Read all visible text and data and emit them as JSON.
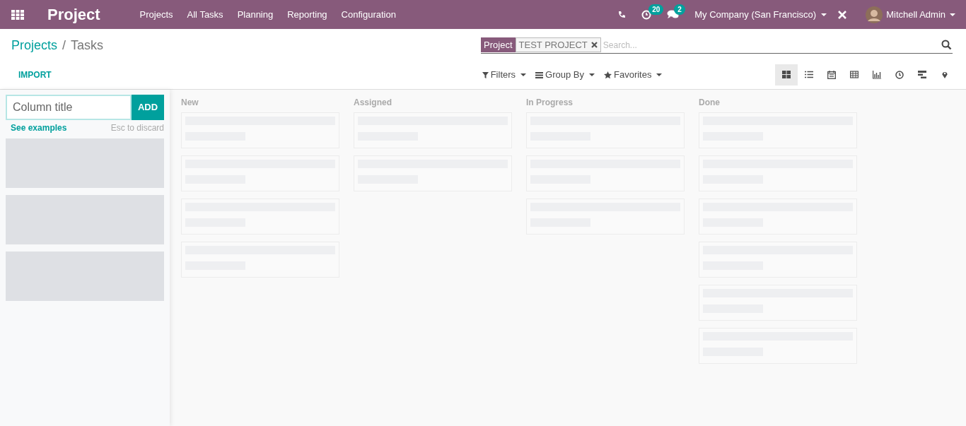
{
  "navbar": {
    "app_name": "Project",
    "menu": [
      "Projects",
      "All Tasks",
      "Planning",
      "Reporting",
      "Configuration"
    ],
    "systray": [
      {
        "kind": "phone"
      },
      {
        "kind": "activity",
        "badge": "20"
      },
      {
        "kind": "messages",
        "badge": "2"
      }
    ],
    "company": "My Company (San Francisco)",
    "user": "Mitchell Admin"
  },
  "breadcrumb": [
    "Projects",
    "Tasks"
  ],
  "breadcrumb_separator": "/",
  "import_button": "IMPORT",
  "search": {
    "facet_label": "Project",
    "facet_value": "TEST PROJECT",
    "placeholder": "Search..."
  },
  "search_options": [
    "Filters",
    "Group By",
    "Favorites"
  ],
  "views": [
    {
      "kind": "kanban",
      "selected": true
    },
    {
      "kind": "list",
      "selected": false
    },
    {
      "kind": "calendar",
      "selected": false
    },
    {
      "kind": "pivot",
      "selected": false
    },
    {
      "kind": "graph",
      "selected": false
    },
    {
      "kind": "activity",
      "selected": false
    },
    {
      "kind": "gantt",
      "selected": false
    },
    {
      "kind": "map",
      "selected": false
    }
  ],
  "quick_create": {
    "placeholder": "Column title",
    "add_button": "ADD",
    "examples_link": "See examples",
    "hint": "Esc to discard",
    "placeholder_blocks": [
      {
        "kind": "block"
      },
      {
        "kind": "block"
      },
      {
        "kind": "block"
      }
    ]
  },
  "columns": [
    {
      "title": "New",
      "cards": [
        {
          "kind": "placeholder"
        },
        {
          "kind": "placeholder"
        },
        {
          "kind": "placeholder"
        },
        {
          "kind": "placeholder"
        }
      ]
    },
    {
      "title": "Assigned",
      "cards": [
        {
          "kind": "placeholder"
        },
        {
          "kind": "placeholder"
        }
      ]
    },
    {
      "title": "In Progress",
      "cards": [
        {
          "kind": "placeholder"
        },
        {
          "kind": "placeholder"
        },
        {
          "kind": "placeholder"
        }
      ]
    },
    {
      "title": "Done",
      "cards": [
        {
          "kind": "placeholder"
        },
        {
          "kind": "placeholder"
        },
        {
          "kind": "placeholder"
        },
        {
          "kind": "placeholder"
        },
        {
          "kind": "placeholder"
        },
        {
          "kind": "placeholder"
        }
      ]
    }
  ]
}
